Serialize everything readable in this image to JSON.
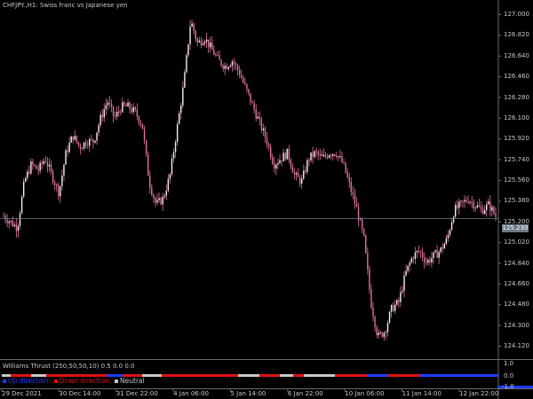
{
  "chart_header": {
    "symbol_title": "CHFJPY.,H1:  Swiss franc vs Japanese yen"
  },
  "indicator": {
    "title": "Williams Thrust (250,50,50,10) 0.5 0.0 0.0",
    "legend": [
      {
        "label": "Up direction",
        "color": "#1e3cff"
      },
      {
        "label": "Down direction",
        "color": "#e01010"
      },
      {
        "label": "Neutral",
        "color": "#c8c8c8"
      }
    ],
    "scale_labels": [
      "1.0",
      "0.0",
      "-1.0"
    ]
  },
  "current_price_label": "125.230",
  "colors": {
    "background": "#000000",
    "candle": "#e070a0",
    "grid": "#3a3a3a",
    "text": "#c8c8c8",
    "up": "#1e3cff",
    "down": "#e01010",
    "neutral": "#c8c8c8"
  },
  "chart_data": {
    "type": "candlestick",
    "title": "CHFJPY.,H1:  Swiss franc vs Japanese yen",
    "ylim": [
      124.14,
      127.06
    ],
    "y_ticks": [
      "127.000",
      "126.820",
      "126.640",
      "126.460",
      "126.280",
      "126.100",
      "125.920",
      "125.740",
      "125.560",
      "125.380",
      "125.200",
      "125.020",
      "124.840",
      "124.660",
      "124.480",
      "124.300",
      "124.120"
    ],
    "x_ticks": [
      "29 Dec 2021",
      "30 Dec 14:00",
      "31 Dec 22:00",
      "4 Jan 06:00",
      "5 Jan 14:00",
      "6 Jan 22:00",
      "10 Jan 06:00",
      "11 Jan 14:00",
      "12 Jan 22:00"
    ],
    "close_path": [
      125.25,
      125.2,
      125.15,
      125.55,
      125.7,
      125.65,
      125.75,
      125.6,
      125.45,
      125.8,
      125.95,
      125.85,
      125.9,
      125.9,
      126.1,
      126.25,
      126.1,
      126.2,
      126.2,
      126.15,
      126.05,
      125.55,
      125.35,
      125.4,
      125.6,
      126.0,
      126.4,
      126.95,
      126.75,
      126.8,
      126.7,
      126.6,
      126.55,
      126.6,
      126.5,
      126.35,
      126.2,
      126.05,
      125.9,
      125.7,
      125.75,
      125.8,
      125.6,
      125.55,
      125.75,
      125.8,
      125.75,
      125.8,
      125.8,
      125.7,
      125.5,
      125.3,
      125.05,
      124.5,
      124.2,
      124.25,
      124.45,
      124.5,
      124.75,
      124.9,
      124.95,
      124.85,
      124.9,
      124.95,
      125.05,
      125.3,
      125.35,
      125.4,
      125.35,
      125.3,
      125.35,
      125.25
    ],
    "last_price": 125.23
  }
}
